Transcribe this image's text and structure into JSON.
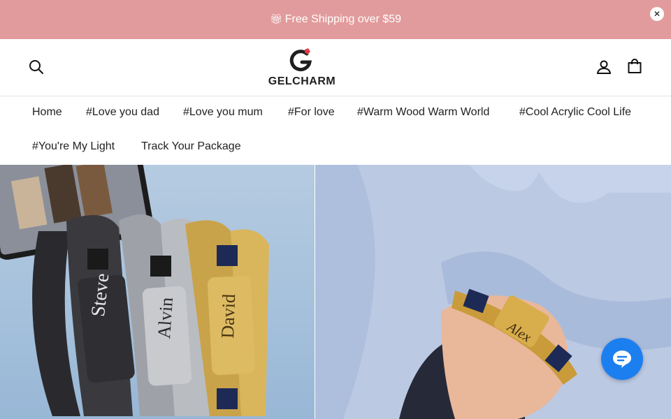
{
  "announcement": {
    "gift_icon": "gift-icon",
    "text": "Free Shipping over $59",
    "close_symbol": "✕"
  },
  "header": {
    "logo_text": "GELCHARM",
    "icons": [
      "search-icon",
      "account-icon",
      "cart-icon"
    ]
  },
  "nav": {
    "items": [
      {
        "label": "Home"
      },
      {
        "label": "#Love you dad"
      },
      {
        "label": "#Love you mum"
      },
      {
        "label": "#For love"
      },
      {
        "label": "#Warm Wood Warm World"
      },
      {
        "label": "#Cool Acrylic Cool Life"
      },
      {
        "label": "#You're My Light"
      },
      {
        "label": "Track Your Package"
      }
    ]
  },
  "hero": {
    "left_engravings": [
      "Steve",
      "Alvin",
      "David"
    ],
    "right_engraving": "Alex"
  },
  "colors": {
    "announcement_bg": "#e29b9c",
    "chat_bg": "#1c7ff0",
    "logo_accent": "#e23a48"
  }
}
